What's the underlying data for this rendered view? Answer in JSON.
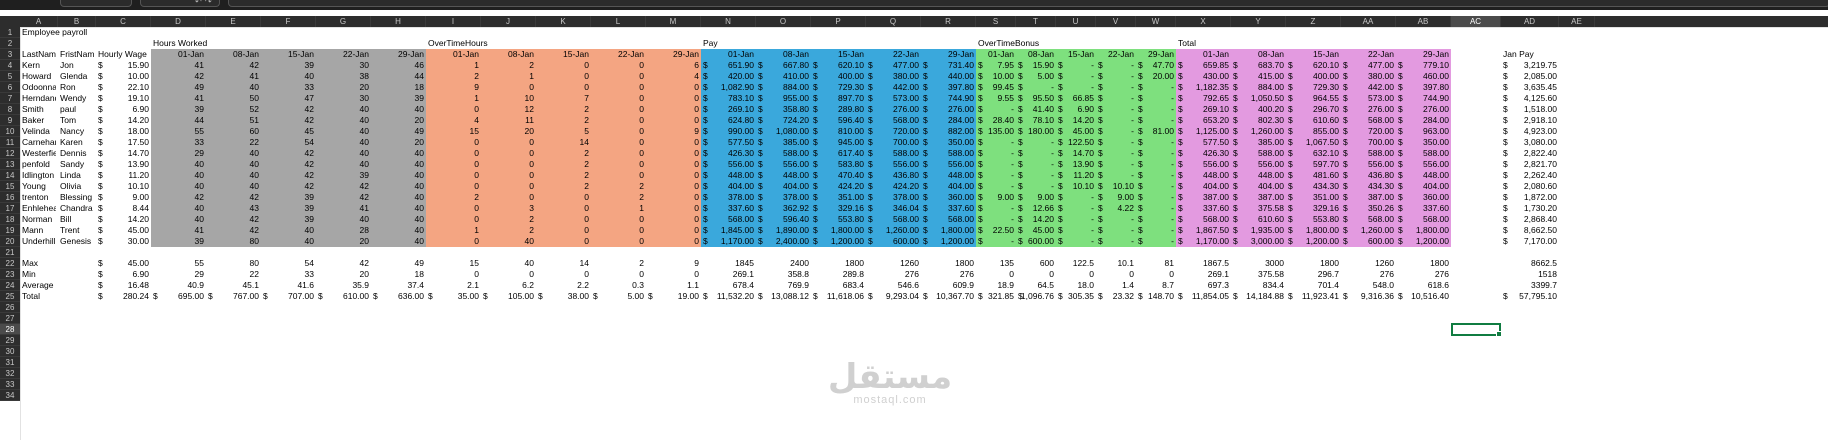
{
  "toolbar": {
    "undo_icon": "undo-icon",
    "redo_icon": "redo-icon"
  },
  "columns": [
    "A",
    "B",
    "C",
    "D",
    "E",
    "F",
    "G",
    "H",
    "I",
    "J",
    "K",
    "L",
    "M",
    "N",
    "O",
    "P",
    "Q",
    "R",
    "S",
    "T",
    "U",
    "V",
    "W",
    "X",
    "Y",
    "Z",
    "AA",
    "AB",
    "AC",
    "AD",
    "AE"
  ],
  "selected_column": "AC",
  "selected_row": 28,
  "row_count": 34,
  "colors": {
    "hours_band": "#a6a6a6",
    "overtime_hours_band": "#f4a582",
    "pay_band": "#3aa8dc",
    "overtime_bonus_band": "#7ee07e",
    "total_band": "#e39ae0",
    "selection": "#107c41"
  },
  "sheet": {
    "title": "Employee payroll",
    "section_headers": {
      "hours": "Hours Worked",
      "overtime_hours": "OverTimeHours",
      "pay": "Pay",
      "overtime_bonus": "OverTimeBonus",
      "total": "Total",
      "jan_pay": "Jan Pay"
    },
    "col_headers": {
      "last": "LastName",
      "first": "FristName",
      "wage": "Hourly Wage"
    },
    "dates": [
      "01-Jan",
      "08-Jan",
      "15-Jan",
      "22-Jan",
      "29-Jan"
    ],
    "employees": [
      {
        "last": "Kern",
        "first": "Jon",
        "wage": "15.90",
        "hours": [
          "41",
          "42",
          "39",
          "30",
          "46"
        ],
        "ot": [
          "1",
          "2",
          "0",
          "0",
          "6"
        ],
        "pay": [
          "651.90",
          "667.80",
          "620.10",
          "477.00",
          "731.40"
        ],
        "bonus": [
          "7.95",
          "15.90",
          "-",
          "-",
          "47.70"
        ],
        "total": [
          "659.85",
          "683.70",
          "620.10",
          "477.00",
          "779.10"
        ],
        "jan": "3,219.75"
      },
      {
        "last": "Howard",
        "first": "Glenda",
        "wage": "10.00",
        "hours": [
          "42",
          "41",
          "40",
          "38",
          "44"
        ],
        "ot": [
          "2",
          "1",
          "0",
          "0",
          "4"
        ],
        "pay": [
          "420.00",
          "410.00",
          "400.00",
          "380.00",
          "440.00"
        ],
        "bonus": [
          "10.00",
          "5.00",
          "-",
          "-",
          "20.00"
        ],
        "total": [
          "430.00",
          "415.00",
          "400.00",
          "380.00",
          "460.00"
        ],
        "jan": "2,085.00"
      },
      {
        "last": "Odoonnak",
        "first": "Ron",
        "wage": "22.10",
        "hours": [
          "49",
          "40",
          "33",
          "20",
          "18"
        ],
        "ot": [
          "9",
          "0",
          "0",
          "0",
          "0"
        ],
        "pay": [
          "1,082.90",
          "884.00",
          "729.30",
          "442.00",
          "397.80"
        ],
        "bonus": [
          "99.45",
          "-",
          "-",
          "-",
          "-"
        ],
        "total": [
          "1,182.35",
          "884.00",
          "729.30",
          "442.00",
          "397.80"
        ],
        "jan": "3,635.45"
      },
      {
        "last": "Herndand",
        "first": "Wendy",
        "wage": "19.10",
        "hours": [
          "41",
          "50",
          "47",
          "30",
          "39"
        ],
        "ot": [
          "1",
          "10",
          "7",
          "0",
          "0"
        ],
        "pay": [
          "783.10",
          "955.00",
          "897.70",
          "573.00",
          "744.90"
        ],
        "bonus": [
          "9.55",
          "95.50",
          "66.85",
          "-",
          "-"
        ],
        "total": [
          "792.65",
          "1,050.50",
          "964.55",
          "573.00",
          "744.90"
        ],
        "jan": "4,125.60"
      },
      {
        "last": "Smith",
        "first": "paul",
        "wage": "6.90",
        "hours": [
          "39",
          "52",
          "42",
          "40",
          "40"
        ],
        "ot": [
          "0",
          "12",
          "2",
          "0",
          "0"
        ],
        "pay": [
          "269.10",
          "358.80",
          "289.80",
          "276.00",
          "276.00"
        ],
        "bonus": [
          "-",
          "41.40",
          "6.90",
          "-",
          "-"
        ],
        "total": [
          "269.10",
          "400.20",
          "296.70",
          "276.00",
          "276.00"
        ],
        "jan": "1,518.00"
      },
      {
        "last": "Baker",
        "first": "Tom",
        "wage": "14.20",
        "hours": [
          "44",
          "51",
          "42",
          "40",
          "20"
        ],
        "ot": [
          "4",
          "11",
          "2",
          "0",
          "0"
        ],
        "pay": [
          "624.80",
          "724.20",
          "596.40",
          "568.00",
          "284.00"
        ],
        "bonus": [
          "28.40",
          "78.10",
          "14.20",
          "-",
          "-"
        ],
        "total": [
          "653.20",
          "802.30",
          "610.60",
          "568.00",
          "284.00"
        ],
        "jan": "2,918.10"
      },
      {
        "last": "Velinda",
        "first": "Nancy",
        "wage": "18.00",
        "hours": [
          "55",
          "60",
          "45",
          "40",
          "49"
        ],
        "ot": [
          "15",
          "20",
          "5",
          "0",
          "9"
        ],
        "pay": [
          "990.00",
          "1,080.00",
          "810.00",
          "720.00",
          "882.00"
        ],
        "bonus": [
          "135.00",
          "180.00",
          "45.00",
          "-",
          "81.00"
        ],
        "total": [
          "1,125.00",
          "1,260.00",
          "855.00",
          "720.00",
          "963.00"
        ],
        "jan": "4,923.00"
      },
      {
        "last": "Carnehan",
        "first": "Karen",
        "wage": "17.50",
        "hours": [
          "33",
          "22",
          "54",
          "40",
          "20"
        ],
        "ot": [
          "0",
          "0",
          "14",
          "0",
          "0"
        ],
        "pay": [
          "577.50",
          "385.00",
          "945.00",
          "700.00",
          "350.00"
        ],
        "bonus": [
          "-",
          "-",
          "122.50",
          "-",
          "-"
        ],
        "total": [
          "577.50",
          "385.00",
          "1,067.50",
          "700.00",
          "350.00"
        ],
        "jan": "3,080.00"
      },
      {
        "last": "Westerfie",
        "first": "Dennis",
        "wage": "14.70",
        "hours": [
          "29",
          "40",
          "42",
          "40",
          "40"
        ],
        "ot": [
          "0",
          "0",
          "2",
          "0",
          "0"
        ],
        "pay": [
          "426.30",
          "588.00",
          "617.40",
          "588.00",
          "588.00"
        ],
        "bonus": [
          "-",
          "-",
          "14.70",
          "-",
          "-"
        ],
        "total": [
          "426.30",
          "588.00",
          "632.10",
          "588.00",
          "588.00"
        ],
        "jan": "2,822.40"
      },
      {
        "last": "penfold",
        "first": "Sandy",
        "wage": "13.90",
        "hours": [
          "40",
          "40",
          "42",
          "40",
          "40"
        ],
        "ot": [
          "0",
          "0",
          "2",
          "0",
          "0"
        ],
        "pay": [
          "556.00",
          "556.00",
          "583.80",
          "556.00",
          "556.00"
        ],
        "bonus": [
          "-",
          "-",
          "13.90",
          "-",
          "-"
        ],
        "total": [
          "556.00",
          "556.00",
          "597.70",
          "556.00",
          "556.00"
        ],
        "jan": "2,821.70"
      },
      {
        "last": "Idlington",
        "first": "Linda",
        "wage": "11.20",
        "hours": [
          "40",
          "40",
          "42",
          "39",
          "40"
        ],
        "ot": [
          "0",
          "0",
          "2",
          "0",
          "0"
        ],
        "pay": [
          "448.00",
          "448.00",
          "470.40",
          "436.80",
          "448.00"
        ],
        "bonus": [
          "-",
          "-",
          "11.20",
          "-",
          "-"
        ],
        "total": [
          "448.00",
          "448.00",
          "481.60",
          "436.80",
          "448.00"
        ],
        "jan": "2,262.40"
      },
      {
        "last": "Young",
        "first": "Olivia",
        "wage": "10.10",
        "hours": [
          "40",
          "40",
          "42",
          "42",
          "40"
        ],
        "ot": [
          "0",
          "0",
          "2",
          "2",
          "0"
        ],
        "pay": [
          "404.00",
          "404.00",
          "424.20",
          "424.20",
          "404.00"
        ],
        "bonus": [
          "-",
          "-",
          "10.10",
          "10.10",
          "-"
        ],
        "total": [
          "404.00",
          "404.00",
          "434.30",
          "434.30",
          "404.00"
        ],
        "jan": "2,080.60"
      },
      {
        "last": "trenton",
        "first": "Blessing",
        "wage": "9.00",
        "hours": [
          "42",
          "42",
          "39",
          "42",
          "40"
        ],
        "ot": [
          "2",
          "0",
          "0",
          "2",
          "0"
        ],
        "pay": [
          "378.00",
          "378.00",
          "351.00",
          "378.00",
          "360.00"
        ],
        "bonus": [
          "9.00",
          "9.00",
          "-",
          "9.00",
          "-"
        ],
        "total": [
          "387.00",
          "387.00",
          "351.00",
          "387.00",
          "360.00"
        ],
        "jan": "1,872.00"
      },
      {
        "last": "Enhlehear",
        "first": "Chandra",
        "wage": "8.44",
        "hours": [
          "40",
          "43",
          "39",
          "41",
          "40"
        ],
        "ot": [
          "0",
          "3",
          "0",
          "1",
          "0"
        ],
        "pay": [
          "337.60",
          "362.92",
          "329.16",
          "346.04",
          "337.60"
        ],
        "bonus": [
          "-",
          "12.66",
          "-",
          "4.22",
          "-"
        ],
        "total": [
          "337.60",
          "375.58",
          "329.16",
          "350.26",
          "337.60"
        ],
        "jan": "1,730.20"
      },
      {
        "last": "Norman",
        "first": "Bill",
        "wage": "14.20",
        "hours": [
          "40",
          "42",
          "39",
          "40",
          "40"
        ],
        "ot": [
          "0",
          "2",
          "0",
          "0",
          "0"
        ],
        "pay": [
          "568.00",
          "596.40",
          "553.80",
          "568.00",
          "568.00"
        ],
        "bonus": [
          "-",
          "14.20",
          "-",
          "-",
          "-"
        ],
        "total": [
          "568.00",
          "610.60",
          "553.80",
          "568.00",
          "568.00"
        ],
        "jan": "2,868.40"
      },
      {
        "last": "Mann",
        "first": "Trent",
        "wage": "45.00",
        "hours": [
          "41",
          "42",
          "40",
          "28",
          "40"
        ],
        "ot": [
          "1",
          "2",
          "0",
          "0",
          "0"
        ],
        "pay": [
          "1,845.00",
          "1,890.00",
          "1,800.00",
          "1,260.00",
          "1,800.00"
        ],
        "bonus": [
          "22.50",
          "45.00",
          "-",
          "-",
          "-"
        ],
        "total": [
          "1,867.50",
          "1,935.00",
          "1,800.00",
          "1,260.00",
          "1,800.00"
        ],
        "jan": "8,662.50"
      },
      {
        "last": "Underhill",
        "first": "Genesis",
        "wage": "30.00",
        "hours": [
          "39",
          "80",
          "40",
          "20",
          "40"
        ],
        "ot": [
          "0",
          "40",
          "0",
          "0",
          "0"
        ],
        "pay": [
          "1,170.00",
          "2,400.00",
          "1,200.00",
          "600.00",
          "1,200.00"
        ],
        "bonus": [
          "-",
          "600.00",
          "-",
          "-",
          "-"
        ],
        "total": [
          "1,170.00",
          "3,000.00",
          "1,200.00",
          "600.00",
          "1,200.00"
        ],
        "jan": "7,170.00"
      }
    ],
    "summary": [
      {
        "label": "Max",
        "wage": "45.00",
        "hours": [
          "55",
          "80",
          "54",
          "42",
          "49"
        ],
        "ot": [
          "15",
          "40",
          "14",
          "2",
          "9"
        ],
        "pay": [
          "1845",
          "2400",
          "1800",
          "1260",
          "1800"
        ],
        "bonus": [
          "135",
          "600",
          "122.5",
          "10.1",
          "81"
        ],
        "total": [
          "1867.5",
          "3000",
          "1800",
          "1260",
          "1800"
        ],
        "jan": "8662.5"
      },
      {
        "label": "Min",
        "wage": "6.90",
        "hours": [
          "29",
          "22",
          "33",
          "20",
          "18"
        ],
        "ot": [
          "0",
          "0",
          "0",
          "0",
          "0"
        ],
        "pay": [
          "269.1",
          "358.8",
          "289.8",
          "276",
          "276"
        ],
        "bonus": [
          "0",
          "0",
          "0",
          "0",
          "0"
        ],
        "total": [
          "269.1",
          "375.58",
          "296.7",
          "276",
          "276"
        ],
        "jan": "1518"
      },
      {
        "label": "Average",
        "wage": "16.48",
        "hours": [
          "40.9",
          "45.1",
          "41.6",
          "35.9",
          "37.4"
        ],
        "ot": [
          "2.1",
          "6.2",
          "2.2",
          "0.3",
          "1.1"
        ],
        "pay": [
          "678.4",
          "769.9",
          "683.4",
          "546.6",
          "609.9"
        ],
        "bonus": [
          "18.9",
          "64.5",
          "18.0",
          "1.4",
          "8.7"
        ],
        "total": [
          "697.3",
          "834.4",
          "701.4",
          "548.0",
          "618.6"
        ],
        "jan": "3399.7"
      },
      {
        "label": "Total",
        "wage": "280.24",
        "hours": [
          "695.00",
          "767.00",
          "707.00",
          "610.00",
          "636.00"
        ],
        "ot": [
          "35.00",
          "105.00",
          "38.00",
          "5.00",
          "19.00"
        ],
        "pay": [
          "11,532.20",
          "13,088.12",
          "11,618.06",
          "9,293.04",
          "10,367.70"
        ],
        "bonus": [
          "321.85",
          "1,096.76",
          "305.35",
          "23.32",
          "148.70"
        ],
        "total": [
          "11,854.05",
          "14,184.88",
          "11,923.41",
          "9,316.36",
          "10,516.40"
        ],
        "jan": "57,795.10"
      }
    ],
    "currency": "$"
  },
  "watermark": {
    "arabic": "مستقل",
    "latin": "mostaql.com"
  }
}
